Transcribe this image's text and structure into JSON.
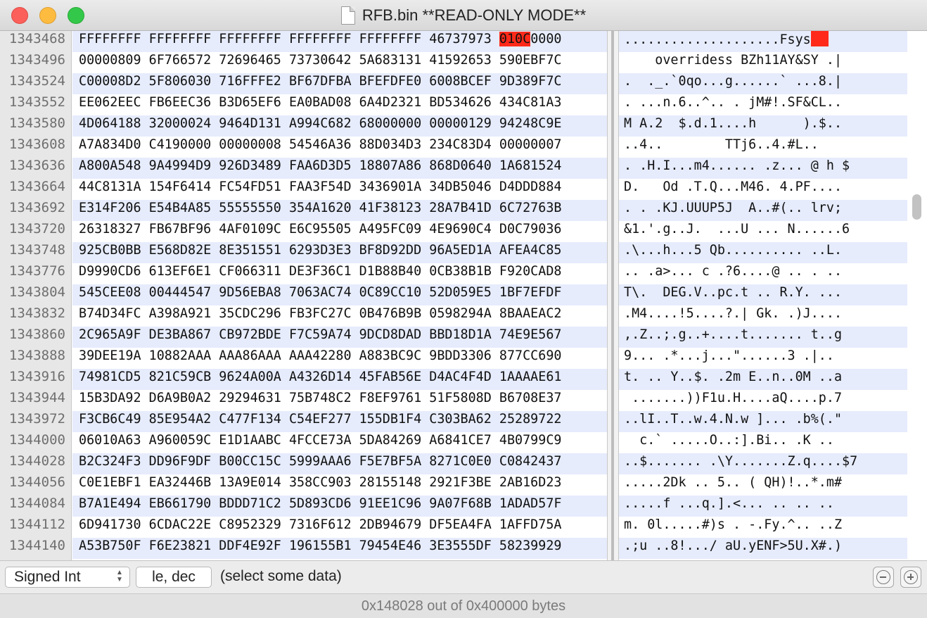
{
  "window": {
    "title": "RFB.bin **READ-ONLY MODE**"
  },
  "offsets": [
    "1343468",
    "1343496",
    "1343524",
    "1343552",
    "1343580",
    "1343608",
    "1343636",
    "1343664",
    "1343692",
    "1343720",
    "1343748",
    "1343776",
    "1343804",
    "1343832",
    "1343860",
    "1343888",
    "1343916",
    "1343944",
    "1343972",
    "1344000",
    "1344028",
    "1344056",
    "1344084",
    "1344112",
    "1344140"
  ],
  "hex_first_row": {
    "before": "FFFFFFFF FFFFFFFF FFFFFFFF FFFFFFFF FFFFFFFF 46737973 ",
    "selected": "010C",
    "after": "0000"
  },
  "hex_rows": [
    "00000809 6F766572 72696465 73730642 5A683131 41592653 590EBF7C",
    "C00008D2 5F806030 716FFFE2 BF67DFBA BFEFDFE0 6008BCEF 9D389F7C",
    "EE062EEC FB6EEC36 B3D65EF6 EA0BAD08 6A4D2321 BD534626 434C81A3",
    "4D064188 32000024 9464D131 A994C682 68000000 00000129 94248C9E",
    "A7A834D0 C4190000 00000008 54546A36 88D034D3 234C83D4 00000007",
    "A800A548 9A4994D9 926D3489 FAA6D3D5 18807A86 868D0640 1A681524",
    "44C8131A 154F6414 FC54FD51 FAA3F54D 3436901A 34DB5046 D4DDD884",
    "E314F206 E54B4A85 55555550 354A1620 41F38123 28A7B41D 6C72763B",
    "26318327 FB67BF96 4AF0109C E6C95505 A495FC09 4E9690C4 D0C79036",
    "925CB0BB E568D82E 8E351551 6293D3E3 BF8D92DD 96A5ED1A AFEA4C85",
    "D9990CD6 613EF6E1 CF066311 DE3F36C1 D1B88B40 0CB38B1B F920CAD8",
    "545CEE08 00444547 9D56EBA8 7063AC74 0C89CC10 52D059E5 1BF7EFDF",
    "B74D34FC A398A921 35CDC296 FB3FC27C 0B476B9B 0598294A 8BAAEAC2",
    "2C965A9F DE3BA867 CB972BDE F7C59A74 9DCD8DAD BBD18D1A 74E9E567",
    "39DEE19A 10882AAA AAA86AAA AAA42280 A883BC9C 9BDD3306 877CC690",
    "74981CD5 821C59CB 9624A00A A4326D14 45FAB56E D4AC4F4D 1AAAAE61",
    "15B3DA92 D6A9B0A2 29294631 75B748C2 F8EF9761 51F5808D B6708E37",
    "F3CB6C49 85E954A2 C477F134 C54EF277 155DB1F4 C303BA62 25289722",
    "06010A63 A960059C E1D1AABC 4FCCE73A 5DA84269 A6841CE7 4B0799C9",
    "B2C324F3 DD96F9DF B00CC15C 5999AAA6 F5E7BF5A 8271C0E0 C0842437",
    "C0E1EBF1 EA32446B 13A9E014 358CC903 28155148 2921F3BE 2AB16D23",
    "B7A1E494 EB661790 BDDD71C2 5D893CD6 91EE1C96 9A07F68B 1ADAD57F",
    "6D941730 6CDAC22E C8952329 7316F612 2DB94679 DF5EA4FA 1AFFD75A",
    "A53B750F F6E23821 DDF4E92F 196155B1 79454E46 3E3555DF 58239929"
  ],
  "ascii_first_row": "....................Fsys",
  "ascii_rows": [
    "    overridess BZh11AY&SY .|",
    ".  ._.`0qo...g......` ...8.|",
    ". ...n.6..^.. . jM#!.SF&CL..",
    "M A.2  $.d.1....h      ).$..",
    "..4..        TTj6..4.#L..",
    ". .H.I...m4...... .z... @ h $",
    "D.   Od .T.Q...M46. 4.PF....",
    ". . .KJ.UUUP5J  A..#(.. lrv;",
    "&1.'.g..J.  ...U ... N......6",
    ".\\...h...5 Qb.......... ..L.",
    ".. .a>... c .?6....@ .. . ..",
    "T\\.  DEG.V..pc.t .. R.Y. ...",
    ".M4....!5....?.| Gk. .)J....",
    ",.Z..;.g..+....t....... t..g",
    "9... .*...j...\"......3 .|..",
    "t. .. Y..$. .2m E..n..0M ..a",
    " .......))F1u.H....aQ....p.7",
    "..lI..T..w.4.N.w ]... .b%(.\"",
    "  c.` .....O..:].Bi.. .K ..",
    "..$....... .\\Y.......Z.q....$7",
    ".....2Dk .. 5.. ( QH)!..*.m#",
    ".....f ...q.].<... .. .. ..",
    "m. 0l.....#)s . -.Fy.^.. ..Z",
    ".;u ..8!.../ aU.yENF>5U.X#.)"
  ],
  "toolbar": {
    "type_select": "Signed Int",
    "endian_button": "le, dec",
    "selection_message": "(select some data)"
  },
  "status": {
    "text": "0x148028 out of 0x400000 bytes"
  }
}
